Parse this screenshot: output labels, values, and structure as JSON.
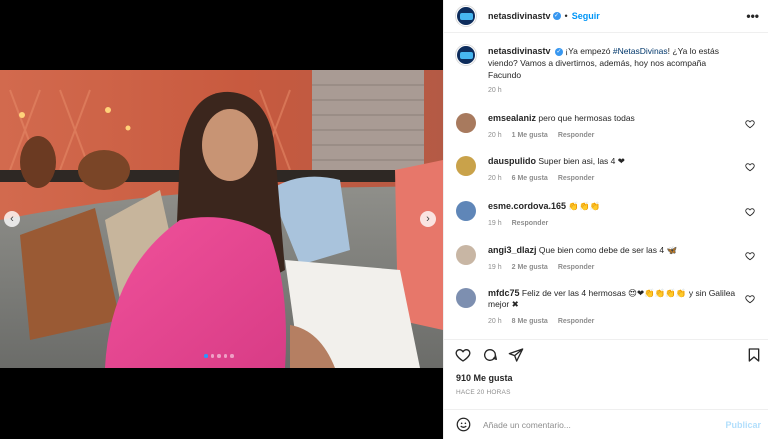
{
  "post": {
    "username": "netasdivinastv",
    "follow_label": "Seguir",
    "more_label": "•••",
    "caption_text": "¡Ya empezó ",
    "caption_hashtag": "#NetasDivinas",
    "caption_rest": "! ¿Ya lo estás viendo? Vamos a divertirnos, además, hoy nos acompaña Facundo",
    "caption_time": "20 h",
    "likes": "910 Me gusta",
    "posted": "HACE 20 HORAS",
    "carousel": {
      "slide_count": 5,
      "active_index": 0
    }
  },
  "comments": [
    {
      "user": "emsealaniz",
      "text": "pero que hermosas todas",
      "time": "20 h",
      "likes": "1 Me gusta",
      "reply": "Responder"
    },
    {
      "user": "dauspulido",
      "text": "Super bien asi, las 4 ❤",
      "time": "20 h",
      "likes": "6 Me gusta",
      "reply": "Responder"
    },
    {
      "user": "esme.cordova.165",
      "text": "👏👏👏",
      "time": "19 h",
      "likes": "",
      "reply": "Responder"
    },
    {
      "user": "angi3_dlazj",
      "text": "Que bien como debe de ser las 4 🦋",
      "time": "19 h",
      "likes": "2 Me gusta",
      "reply": "Responder"
    },
    {
      "user": "mfdc75",
      "text": "Feliz de ver las 4 hermosas 😍❤👏👏👏👏 y sin Galilea mejor ✖",
      "time": "20 h",
      "likes": "8 Me gusta",
      "reply": "Responder"
    }
  ],
  "add_comment": {
    "placeholder": "Añade un comentario...",
    "publish_label": "Publicar"
  },
  "colors": {
    "accent": "#0095f6",
    "verified": "#3897f0",
    "muted": "#8e8e8e",
    "border": "#efefef"
  }
}
